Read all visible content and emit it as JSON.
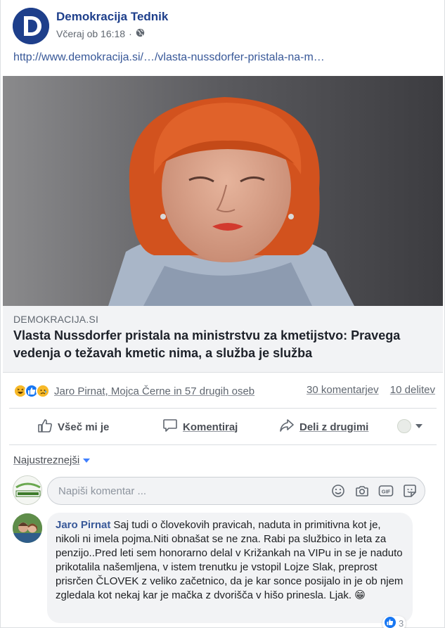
{
  "post": {
    "page_name": "Demokracija Tednik",
    "timestamp": "Včeraj ob 16:18",
    "separator": "·",
    "audience_icon": "globe-icon",
    "link_url": "http://www.demokracija.si/…/vlasta-nussdorfer-pristala-na-m…"
  },
  "preview": {
    "domain": "DEMOKRACIJA.SI",
    "headline": "Vlasta Nussdorfer pristala na ministrstvu za kmetijstvo: Pravega vedenja o težavah kmetic nima, a služba je služba"
  },
  "reactions": {
    "icons": [
      "haha-icon",
      "like-icon",
      "sad-icon"
    ],
    "names": "Jaro Pirnat, Mojca Černe in 57 drugih oseb",
    "comments": "30 komentarjev",
    "shares": "10 delitev"
  },
  "actions": {
    "like": "Všeč mi je",
    "comment": "Komentiraj",
    "share": "Deli z drugimi"
  },
  "sort": {
    "label": "Najustreznejši"
  },
  "composer": {
    "placeholder": "Napiši komentar ..."
  },
  "comment": {
    "author": "Jaro Pirnat",
    "text": "Saj tudi o človekovih pravicah, naduta in primitivna kot je, nikoli ni imela pojma.Niti obnašat se ne zna. Rabi pa službico in leta za penzijo..Pred leti sem honorarno delal v Križankah na VIPu in se je naduto prikotalila našemljena, v istem trenutku je vstopil Lojze Slak, preprost prisrčen ČLOVEK z veliko začetnico, da je kar sonce posijalo in je ob njem zgledala kot nekaj kar je mačka z dvorišča v hišo prinesla. Ljak. 😁",
    "likes": "3"
  },
  "colors": {
    "brand": "#1e3f8b",
    "link": "#385898",
    "accent": "#4080ff"
  }
}
